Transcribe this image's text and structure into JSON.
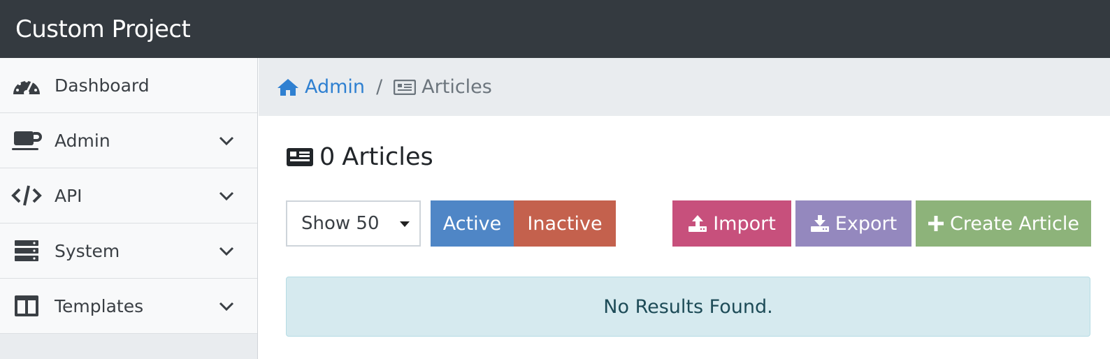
{
  "app": {
    "title": "Custom Project"
  },
  "sidebar": {
    "items": [
      {
        "label": "Dashboard",
        "icon": "tachometer-icon",
        "expandable": false
      },
      {
        "label": "Admin",
        "icon": "coffee-icon",
        "expandable": true
      },
      {
        "label": "API",
        "icon": "code-icon",
        "expandable": true
      },
      {
        "label": "System",
        "icon": "server-icon",
        "expandable": true
      },
      {
        "label": "Templates",
        "icon": "columns-icon",
        "expandable": true
      }
    ]
  },
  "breadcrumb": {
    "home_label": "Admin",
    "separator": "/",
    "current_label": "Articles"
  },
  "page": {
    "count": "0",
    "title_word": "Articles"
  },
  "toolbar": {
    "show_select": {
      "selected": "Show 50"
    },
    "active_label": "Active",
    "inactive_label": "Inactive",
    "import_label": "Import",
    "export_label": "Export",
    "create_label": "Create Article"
  },
  "results": {
    "empty_message": "No Results Found."
  },
  "colors": {
    "topbar": "#343a40",
    "active": "#4f86c6",
    "inactive": "#c4614d",
    "import": "#c7507c",
    "export": "#9488be",
    "create": "#8db37a",
    "alert_bg": "#d6eaef",
    "link": "#2f80d1"
  }
}
